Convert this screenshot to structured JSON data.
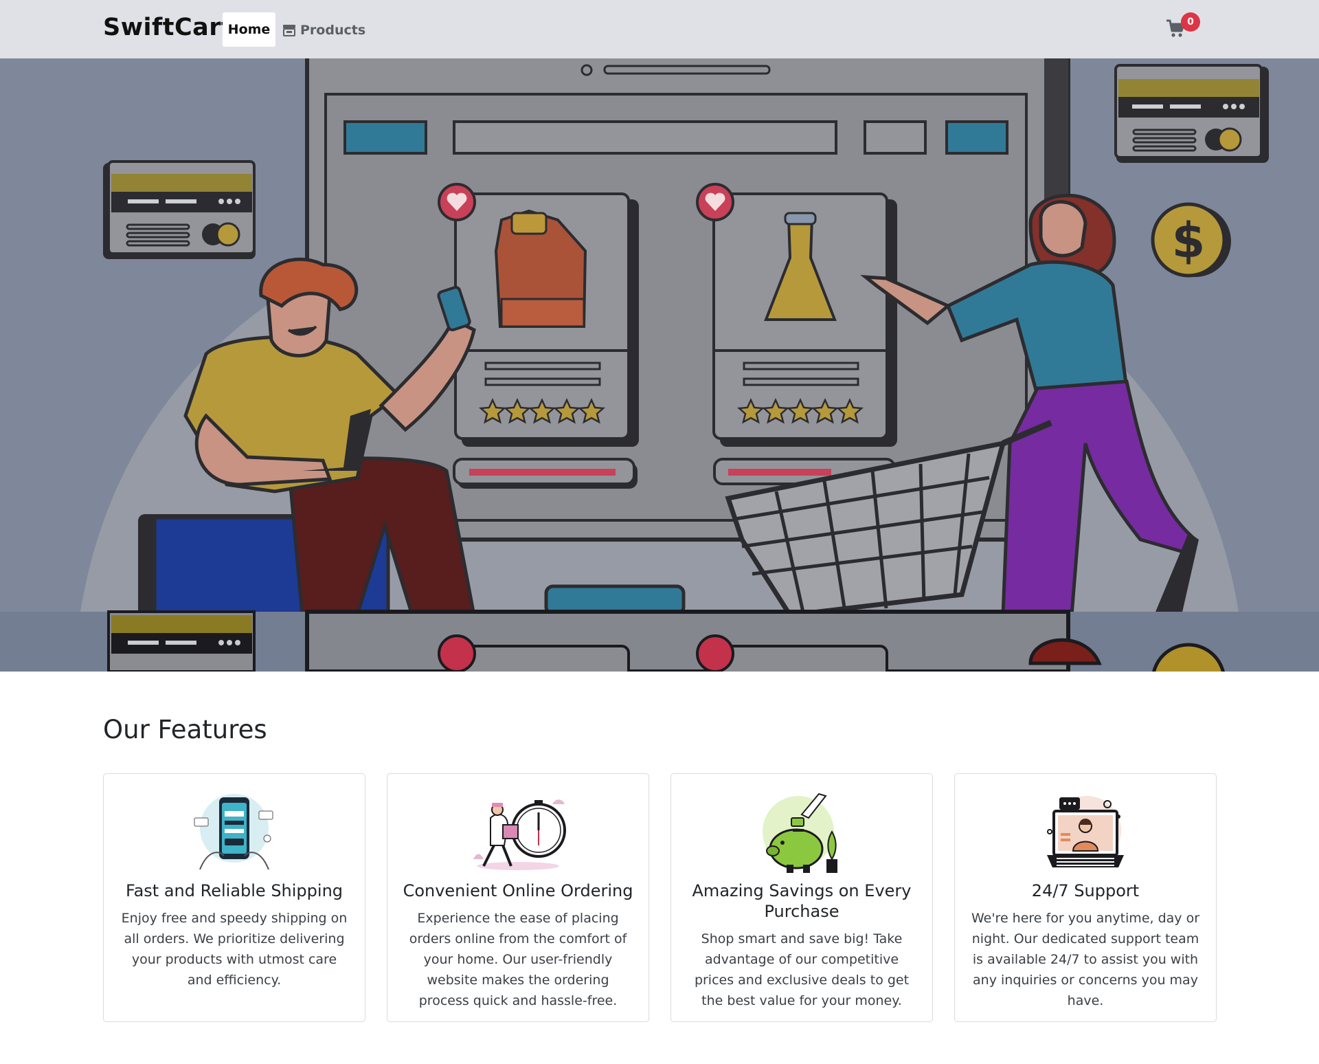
{
  "nav": {
    "brand": "SwiftCart",
    "home_label": "Home",
    "products_label": "Products",
    "cart_count": "0"
  },
  "features": {
    "title": "Our Features",
    "cards": [
      {
        "title": "Fast and Reliable Shipping",
        "text": "Enjoy free and speedy shipping on all orders. We prioritize delivering your products with utmost care and efficiency.",
        "image": "mobile-payment-illustration"
      },
      {
        "title": "Convenient Online Ordering",
        "text": "Experience the ease of placing orders online from the comfort of your home. Our user-friendly website makes the ordering process quick and hassle-free.",
        "image": "delivery-clock-illustration"
      },
      {
        "title": "Amazing Savings on Every Purchase",
        "text": "Shop smart and save big! Take advantage of our competitive prices and exclusive deals to get the best value for your money.",
        "image": "piggy-bank-illustration"
      },
      {
        "title": "24/7 Support",
        "text": "We're here for you anytime, day or night. Our dedicated support team is available 24/7 to assist you with any inquiries or concerns you may have.",
        "image": "support-laptop-illustration"
      }
    ]
  },
  "colors": {
    "navbar_bg": "#dfe1e6",
    "hero_bg": "#737e92",
    "badge_red": "#dc3545",
    "accent_gold": "#b0912a",
    "accent_teal": "#1f7aa0",
    "heart_red": "#c4314b"
  }
}
